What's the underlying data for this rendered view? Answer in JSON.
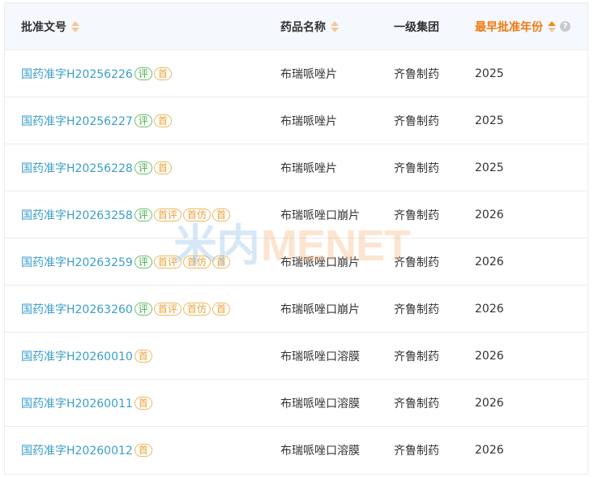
{
  "header": {
    "col1": "批准文号",
    "col2": "药品名称",
    "col3": "一级集团",
    "col4": "最早批准年份",
    "help": "?"
  },
  "rows": [
    {
      "approval": "国药准字H20256226",
      "badges": [
        "评",
        "首"
      ],
      "name": "布瑞哌唑片",
      "group": "齐鲁制药",
      "year": "2025"
    },
    {
      "approval": "国药准字H20256227",
      "badges": [
        "评",
        "首"
      ],
      "name": "布瑞哌唑片",
      "group": "齐鲁制药",
      "year": "2025"
    },
    {
      "approval": "国药准字H20256228",
      "badges": [
        "评",
        "首"
      ],
      "name": "布瑞哌唑片",
      "group": "齐鲁制药",
      "year": "2025"
    },
    {
      "approval": "国药准字H20263258",
      "badges": [
        "评",
        "首评",
        "首仿",
        "首"
      ],
      "name": "布瑞哌唑口崩片",
      "group": "齐鲁制药",
      "year": "2026"
    },
    {
      "approval": "国药准字H20263259",
      "badges": [
        "评",
        "首评",
        "首仿",
        "首"
      ],
      "name": "布瑞哌唑口崩片",
      "group": "齐鲁制药",
      "year": "2026"
    },
    {
      "approval": "国药准字H20263260",
      "badges": [
        "评",
        "首评",
        "首仿",
        "首"
      ],
      "name": "布瑞哌唑口崩片",
      "group": "齐鲁制药",
      "year": "2026"
    },
    {
      "approval": "国药准字H20260010",
      "badges": [
        "首"
      ],
      "name": "布瑞哌唑口溶膜",
      "group": "齐鲁制药",
      "year": "2026"
    },
    {
      "approval": "国药准字H20260011",
      "badges": [
        "首"
      ],
      "name": "布瑞哌唑口溶膜",
      "group": "齐鲁制药",
      "year": "2026"
    },
    {
      "approval": "国药准字H20260012",
      "badges": [
        "首"
      ],
      "name": "布瑞哌唑口溶膜",
      "group": "齐鲁制药",
      "year": "2026"
    }
  ],
  "watermark": {
    "cn": "米内",
    "en": "MENET"
  },
  "colors": {
    "link": "#3a9ecb",
    "badge_green": "#4cae4c",
    "badge_orange": "#e8a33a",
    "active_sort": "#f07a12"
  }
}
